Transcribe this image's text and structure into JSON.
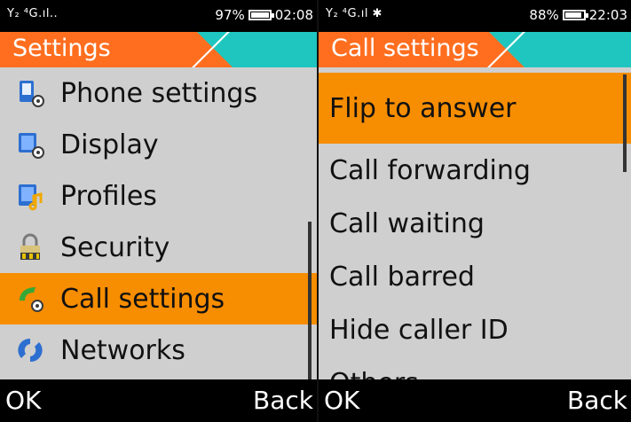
{
  "left": {
    "status": {
      "signal": "Y₂ ⁴G.ıl..",
      "battery_text": "97%",
      "battery_level": 0.97,
      "time": "02:08"
    },
    "title": "Settings",
    "items": [
      {
        "label": "Phone settings",
        "icon": "phone-settings-icon"
      },
      {
        "label": "Display",
        "icon": "display-icon"
      },
      {
        "label": "Profiles",
        "icon": "profiles-icon"
      },
      {
        "label": "Security",
        "icon": "lock-icon"
      },
      {
        "label": "Call settings",
        "icon": "call-settings-icon",
        "selected": true
      },
      {
        "label": "Networks",
        "icon": "networks-icon"
      }
    ],
    "softkeys": {
      "left": "OK",
      "right": "Back"
    }
  },
  "right": {
    "status": {
      "signal": "Y₂ ⁴G.ıl ✱",
      "battery_text": "88%",
      "battery_level": 0.88,
      "time": "22:03"
    },
    "title": "Call settings",
    "items": [
      {
        "label": "Flip to answer",
        "selected": true
      },
      {
        "label": "Call forwarding"
      },
      {
        "label": "Call waiting"
      },
      {
        "label": "Call barred"
      },
      {
        "label": "Hide caller ID"
      },
      {
        "label": "Others"
      }
    ],
    "softkeys": {
      "left": "OK",
      "right": "Back"
    }
  },
  "colors": {
    "accent_orange": "#ff6e1f",
    "teal": "#1fc6c0",
    "selection": "#f78d00",
    "list_bg": "#cfcfcf"
  }
}
